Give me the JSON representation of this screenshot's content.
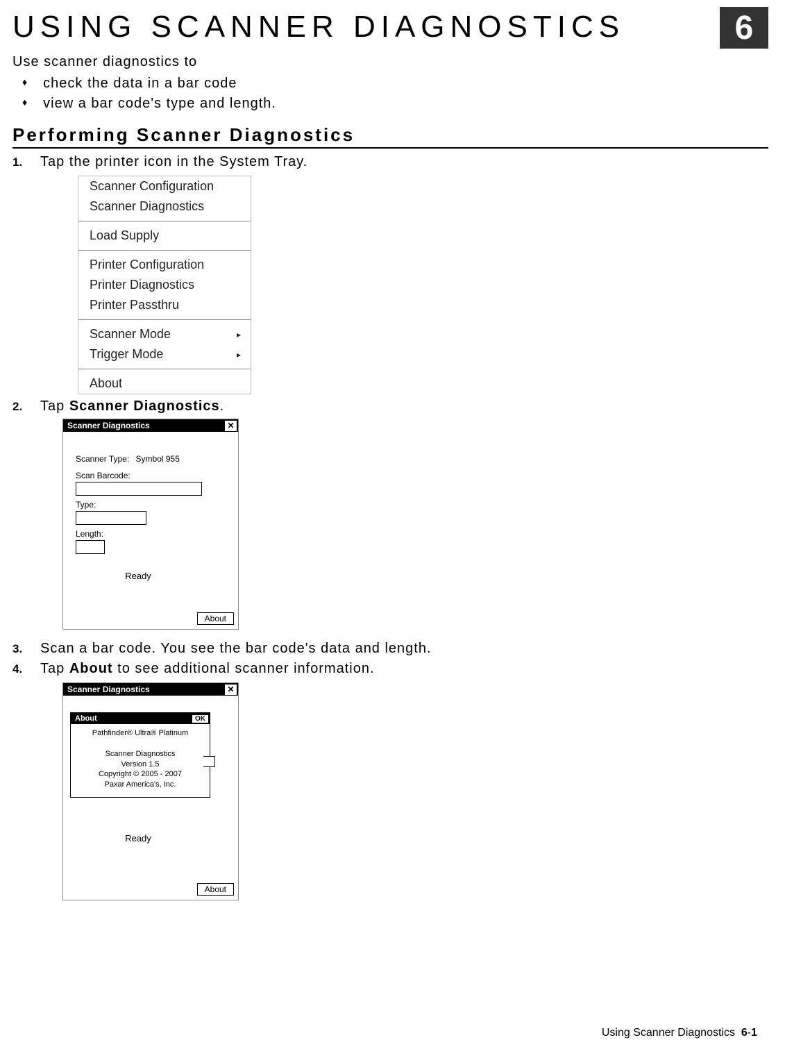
{
  "chapter": {
    "title": "USING SCANNER DIAGNOSTICS",
    "badge": "6"
  },
  "intro": "Use scanner diagnostics to",
  "bullets": [
    "check the data in a bar code",
    "view a bar code's type and length."
  ],
  "section_heading": "Performing Scanner Diagnostics",
  "steps": {
    "s1": {
      "num": "1.",
      "text": "Tap the printer icon in the System Tray."
    },
    "s2": {
      "num": "2.",
      "pre": "Tap ",
      "bold": "Scanner Diagnostics",
      "post": "."
    },
    "s3": {
      "num": "3.",
      "text": "Scan a bar code.  You see the bar code's data and length."
    },
    "s4": {
      "num": "4.",
      "pre": "Tap ",
      "bold": "About",
      "post": " to see additional scanner information."
    }
  },
  "menu": {
    "items": {
      "scanner_config": "Scanner Configuration",
      "scanner_diag": "Scanner Diagnostics",
      "load_supply": "Load Supply",
      "printer_config": "Printer Configuration",
      "printer_diag": "Printer Diagnostics",
      "printer_pass": "Printer Passthru",
      "scanner_mode": "Scanner Mode",
      "trigger_mode": "Trigger Mode",
      "about": "About"
    },
    "arrow": "▸"
  },
  "sswin": {
    "title": "Scanner Diagnostics",
    "close": "✕",
    "scanner_type_label": "Scanner Type:",
    "scanner_type_value": "Symbol 955",
    "scan_barcode_label": "Scan Barcode:",
    "type_label": "Type:",
    "length_label": "Length:",
    "ready": "Ready",
    "about_btn": "About"
  },
  "about_dialog": {
    "title": "About",
    "ok": "OK",
    "line1": "Pathfinder® Ultra® Platinum",
    "line2": "Scanner Diagnostics",
    "line3": "Version 1.5",
    "line4": "Copyright © 2005 - 2007",
    "line5": "Paxar America's, Inc."
  },
  "footer": {
    "label": "Using Scanner Diagnostics",
    "page_a": "6",
    "dash": "-",
    "page_b": "1"
  }
}
